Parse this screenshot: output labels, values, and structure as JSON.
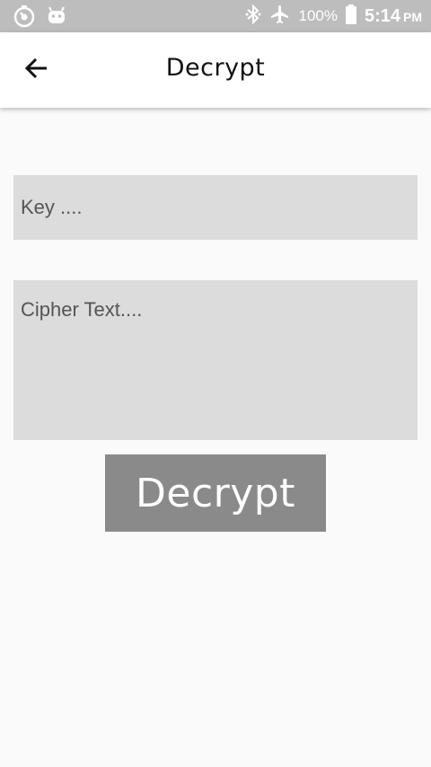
{
  "status_bar": {
    "battery_percent": "100%",
    "time": "5:14",
    "ampm": "PM",
    "icons": [
      "timer-icon",
      "android-icon",
      "bluetooth-icon",
      "airplane-icon",
      "battery-icon"
    ]
  },
  "app_bar": {
    "title": "Decrypt",
    "back_icon": "arrow-left-icon"
  },
  "form": {
    "key_placeholder": "Key ....",
    "key_value": "",
    "cipher_placeholder": "Cipher Text....",
    "cipher_value": "",
    "decrypt_label": "Decrypt"
  },
  "colors": {
    "status_bar_bg": "#bdbdbd",
    "app_bar_bg": "#ffffff",
    "page_bg": "#fafafa",
    "field_bg": "#dcdcdc",
    "button_bg": "#8a8a8a",
    "button_text": "#ffffff"
  }
}
